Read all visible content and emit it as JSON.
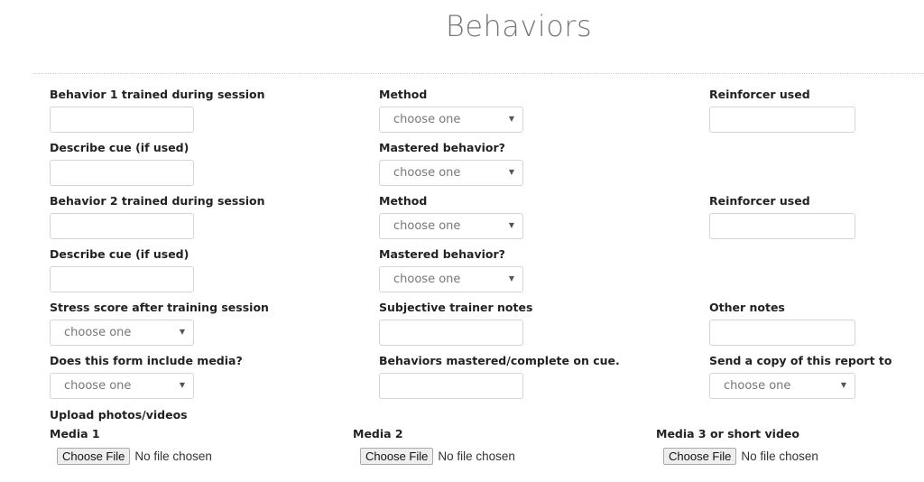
{
  "page_title": "Behaviors",
  "fields": {
    "behavior1": {
      "label": "Behavior 1 trained during session",
      "value": ""
    },
    "method1": {
      "label": "Method",
      "selected": "choose one"
    },
    "reinforcer1": {
      "label": "Reinforcer used",
      "value": ""
    },
    "cue1": {
      "label": "Describe cue (if used)",
      "value": ""
    },
    "mastered1": {
      "label": "Mastered behavior?",
      "selected": "choose one"
    },
    "behavior2": {
      "label": "Behavior 2 trained during session",
      "value": ""
    },
    "method2": {
      "label": "Method",
      "selected": "choose one"
    },
    "reinforcer2": {
      "label": "Reinforcer used",
      "value": ""
    },
    "cue2": {
      "label": "Describe cue (if used)",
      "value": ""
    },
    "mastered2": {
      "label": "Mastered behavior?",
      "selected": "choose one"
    },
    "stress": {
      "label": "Stress score after training session",
      "selected": "choose one"
    },
    "trainer_notes": {
      "label": "Subjective trainer notes",
      "value": ""
    },
    "other_notes": {
      "label": "Other notes",
      "value": ""
    },
    "media_included": {
      "label": "Does this form include media?",
      "selected": "choose one"
    },
    "mastered_on_cue": {
      "label": "Behaviors mastered/complete on cue.",
      "value": ""
    },
    "send_copy": {
      "label": "Send a copy of this report to",
      "selected": "choose one"
    }
  },
  "upload": {
    "heading": "Upload photos/videos",
    "items": [
      {
        "label": "Media 1",
        "button": "Choose File",
        "status": "No file chosen"
      },
      {
        "label": "Media 2",
        "button": "Choose File",
        "status": "No file chosen"
      },
      {
        "label": "Media 3 or short video",
        "button": "Choose File",
        "status": "No file chosen"
      }
    ]
  }
}
